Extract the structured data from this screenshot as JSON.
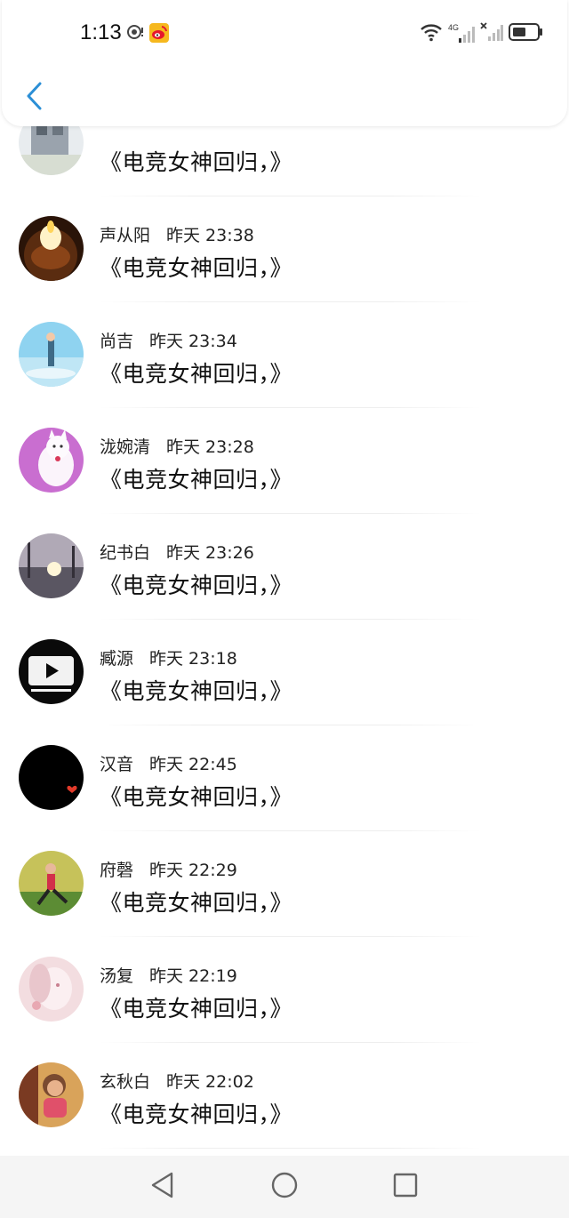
{
  "status_bar": {
    "time": "1:13",
    "network_label": "4G",
    "icons": [
      "location-icon",
      "weibo-icon",
      "wifi-icon",
      "signal-icon",
      "signal-x-icon",
      "battery-icon"
    ]
  },
  "header": {
    "back_icon": "chevron-left-icon"
  },
  "comments": [
    {
      "name": "",
      "time": "",
      "text": "《电竞女神回归，》",
      "avatar": "building-photo"
    },
    {
      "name": "声从阳",
      "time": "昨天 23:38",
      "text": "《电竞女神回归，》",
      "avatar": "candle-photo"
    },
    {
      "name": "尚吉",
      "time": "昨天 23:34",
      "text": "《电竞女神回归，》",
      "avatar": "sky-figure-photo"
    },
    {
      "name": "泷婉清",
      "time": "昨天 23:28",
      "text": "《电竞女神回归，》",
      "avatar": "cat-drawing"
    },
    {
      "name": "纪书白",
      "time": "昨天 23:26",
      "text": "《电竞女神回归，》",
      "avatar": "sunset-photo"
    },
    {
      "name": "臧源",
      "time": "昨天 23:18",
      "text": "《电竞女神回归，》",
      "avatar": "tv-play-icon"
    },
    {
      "name": "汉音",
      "time": "昨天 22:45",
      "text": "《电竞女神回归，》",
      "avatar": "black-heart"
    },
    {
      "name": "府磬",
      "time": "昨天 22:29",
      "text": "《电竞女神回归，》",
      "avatar": "yoga-photo"
    },
    {
      "name": "汤复",
      "time": "昨天 22:19",
      "text": "《电竞女神回归，》",
      "avatar": "anime-photo"
    },
    {
      "name": "玄秋白",
      "time": "昨天 22:02",
      "text": "《电竞女神回归，》",
      "avatar": "girl-photo"
    }
  ],
  "navbar": {
    "icons": [
      "back-triangle-icon",
      "home-circle-icon",
      "recents-square-icon"
    ]
  },
  "colors": {
    "accent": "#2b8fd6",
    "text": "#111111",
    "divider": "#eeeeee"
  }
}
